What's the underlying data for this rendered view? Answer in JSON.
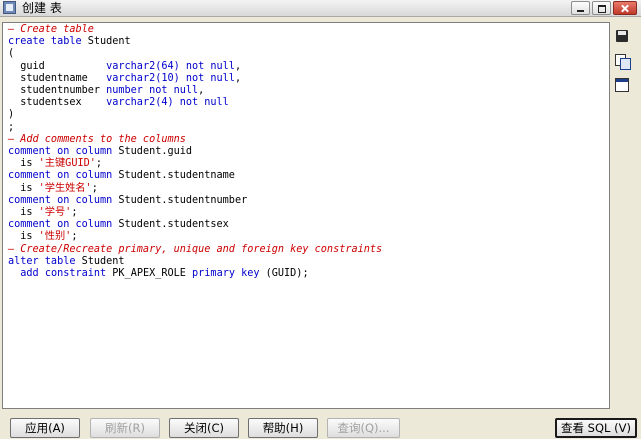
{
  "window": {
    "title": "创建 表"
  },
  "code_lines": [
    [
      {
        "t": "cm",
        "v": "— Create table"
      }
    ],
    [
      {
        "t": "kw",
        "v": "create table "
      },
      {
        "t": "txt",
        "v": "Student"
      }
    ],
    [
      {
        "t": "txt",
        "v": "("
      }
    ],
    [
      {
        "t": "txt",
        "v": "  guid          "
      },
      {
        "t": "kw",
        "v": "varchar2(64) not null"
      },
      {
        "t": "txt",
        "v": ","
      }
    ],
    [
      {
        "t": "txt",
        "v": "  studentname   "
      },
      {
        "t": "kw",
        "v": "varchar2(10) not null"
      },
      {
        "t": "txt",
        "v": ","
      }
    ],
    [
      {
        "t": "txt",
        "v": "  studentnumber "
      },
      {
        "t": "kw",
        "v": "number not null"
      },
      {
        "t": "txt",
        "v": ","
      }
    ],
    [
      {
        "t": "txt",
        "v": "  studentsex    "
      },
      {
        "t": "kw",
        "v": "varchar2(4) not null"
      }
    ],
    [
      {
        "t": "txt",
        "v": ")"
      }
    ],
    [
      {
        "t": "txt",
        "v": ";"
      }
    ],
    [
      {
        "t": "cm",
        "v": "— Add comments to the columns"
      }
    ],
    [
      {
        "t": "kw",
        "v": "comment on column "
      },
      {
        "t": "txt",
        "v": "Student.guid"
      }
    ],
    [
      {
        "t": "txt",
        "v": "  is "
      },
      {
        "t": "str",
        "v": "'主键GUID'"
      },
      {
        "t": "txt",
        "v": ";"
      }
    ],
    [
      {
        "t": "kw",
        "v": "comment on column "
      },
      {
        "t": "txt",
        "v": "Student.studentname"
      }
    ],
    [
      {
        "t": "txt",
        "v": "  is "
      },
      {
        "t": "str",
        "v": "'学生姓名'"
      },
      {
        "t": "txt",
        "v": ";"
      }
    ],
    [
      {
        "t": "kw",
        "v": "comment on column "
      },
      {
        "t": "txt",
        "v": "Student.studentnumber"
      }
    ],
    [
      {
        "t": "txt",
        "v": "  is "
      },
      {
        "t": "str",
        "v": "'学号'"
      },
      {
        "t": "txt",
        "v": ";"
      }
    ],
    [
      {
        "t": "kw",
        "v": "comment on column "
      },
      {
        "t": "txt",
        "v": "Student.studentsex"
      }
    ],
    [
      {
        "t": "txt",
        "v": "  is "
      },
      {
        "t": "str",
        "v": "'性别'"
      },
      {
        "t": "txt",
        "v": ";"
      }
    ],
    [
      {
        "t": "cm",
        "v": "— Create/Recreate primary, unique and foreign key constraints"
      }
    ],
    [
      {
        "t": "kw",
        "v": "alter table "
      },
      {
        "t": "txt",
        "v": "Student"
      }
    ],
    [
      {
        "t": "txt",
        "v": "  "
      },
      {
        "t": "kw",
        "v": "add constraint "
      },
      {
        "t": "txt",
        "v": "PK_APEX_ROLE "
      },
      {
        "t": "kw",
        "v": "primary key "
      },
      {
        "t": "txt",
        "v": "(GUID);"
      }
    ]
  ],
  "side_tools": [
    {
      "name": "save-icon",
      "icon": "save"
    },
    {
      "name": "copy-icon",
      "icon": "copy"
    },
    {
      "name": "view-icon",
      "icon": "view"
    }
  ],
  "buttons": {
    "apply": "应用(A)",
    "refresh": "刷新(R)",
    "close": "关闭(C)",
    "help": "帮助(H)",
    "query": "查询(Q)...",
    "view_sql": "查看 SQL (V)"
  }
}
